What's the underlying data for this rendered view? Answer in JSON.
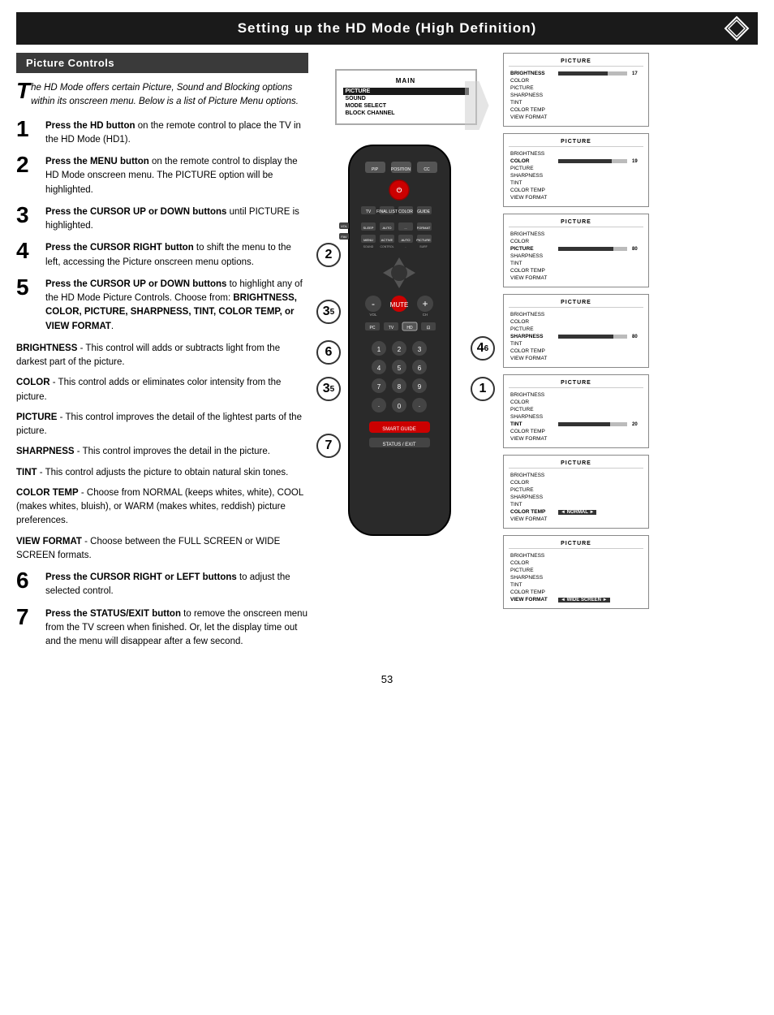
{
  "page": {
    "title": "Setting up the HD Mode (High Definition)",
    "page_number": "53"
  },
  "section": {
    "title": "Picture Controls"
  },
  "intro": {
    "drop_cap": "T",
    "text": "he HD Mode offers certain Picture, Sound and Blocking options within its onscreen menu. Below is a list of Picture Menu options."
  },
  "steps": [
    {
      "number": "1",
      "text": "Press the HD button on the remote control to place the TV in the HD Mode (HD1)."
    },
    {
      "number": "2",
      "text": "Press the MENU button on the remote control to display the HD Mode onscreen menu. The PICTURE option will be highlighted."
    },
    {
      "number": "3",
      "text": "Press the CURSOR UP or DOWN buttons until PICTURE is highlighted."
    },
    {
      "number": "4",
      "text": "Press the CURSOR RIGHT button to shift the menu to the left, accessing the Picture onscreen menu options."
    },
    {
      "number": "5",
      "text": "Press the CURSOR UP or DOWN buttons to highlight any of the HD Mode Picture Controls. Choose from: BRIGHTNESS, COLOR, PICTURE, SHARPNESS, TINT, COLOR TEMP, or VIEW FORMAT."
    }
  ],
  "descriptions": [
    {
      "term": "BRIGHTNESS",
      "text": "This control will adds or subtracts light from the darkest part of the picture."
    },
    {
      "term": "COLOR",
      "text": "This control adds or eliminates color intensity from the picture."
    },
    {
      "term": "PICTURE",
      "text": "This control improves the detail of the lightest parts of the picture."
    },
    {
      "term": "SHARPNESS",
      "text": "This control improves the detail in the picture."
    },
    {
      "term": "TINT",
      "text": "This control adjusts the picture to obtain natural skin tones."
    },
    {
      "term": "COLOR TEMP",
      "text": "Choose from NORMAL (keeps whites, white), COOL (makes whites, bluish), or WARM (makes whites, reddish) picture preferences."
    },
    {
      "term": "VIEW FORMAT",
      "text": "Choose between the FULL SCREEN or WIDE SCREEN formats."
    }
  ],
  "bottom_steps": [
    {
      "number": "6",
      "text": "Press the CURSOR RIGHT or LEFT buttons to adjust the selected control."
    },
    {
      "number": "7",
      "text": "Press the STATUS/EXIT button to remove the onscreen menu from the TV screen when finished. Or, let the display time out and the menu will disappear after a few second."
    }
  ],
  "tv_main_menu": {
    "title": "MAIN",
    "items": [
      "PICTURE",
      "SOUND",
      "MODE SELECT",
      "BLOCK CHANNEL"
    ],
    "highlighted": 0
  },
  "screenshots": [
    {
      "title": "PICTURE",
      "rows": [
        {
          "label": "BRIGHTNESS",
          "active": true,
          "has_bar": true,
          "bar_pct": 72,
          "value": "17"
        },
        {
          "label": "COLOR",
          "active": false,
          "has_bar": false
        },
        {
          "label": "PICTURE",
          "active": false,
          "has_bar": false
        },
        {
          "label": "SHARPNESS",
          "active": false,
          "has_bar": false
        },
        {
          "label": "TINT",
          "active": false,
          "has_bar": false
        },
        {
          "label": "COLOR TEMP",
          "active": false,
          "has_bar": false
        },
        {
          "label": "VIEW FORMAT",
          "active": false,
          "has_bar": false
        }
      ]
    },
    {
      "title": "PICTURE",
      "rows": [
        {
          "label": "BRIGHTNESS",
          "active": false,
          "has_bar": false
        },
        {
          "label": "COLOR",
          "active": true,
          "has_bar": true,
          "bar_pct": 78,
          "value": "19"
        },
        {
          "label": "PICTURE",
          "active": false,
          "has_bar": false
        },
        {
          "label": "SHARPNESS",
          "active": false,
          "has_bar": false
        },
        {
          "label": "TINT",
          "active": false,
          "has_bar": false
        },
        {
          "label": "COLOR TEMP",
          "active": false,
          "has_bar": false
        },
        {
          "label": "VIEW FORMAT",
          "active": false,
          "has_bar": false
        }
      ]
    },
    {
      "title": "PICTURE",
      "rows": [
        {
          "label": "BRIGHTNESS",
          "active": false,
          "has_bar": false
        },
        {
          "label": "COLOR",
          "active": false,
          "has_bar": false
        },
        {
          "label": "PICTURE",
          "active": true,
          "has_bar": true,
          "bar_pct": 80,
          "value": "80"
        },
        {
          "label": "SHARPNESS",
          "active": false,
          "has_bar": false
        },
        {
          "label": "TINT",
          "active": false,
          "has_bar": false
        },
        {
          "label": "COLOR TEMP",
          "active": false,
          "has_bar": false
        },
        {
          "label": "VIEW FORMAT",
          "active": false,
          "has_bar": false
        }
      ]
    },
    {
      "title": "PICTURE",
      "rows": [
        {
          "label": "BRIGHTNESS",
          "active": false,
          "has_bar": false
        },
        {
          "label": "COLOR",
          "active": false,
          "has_bar": false
        },
        {
          "label": "PICTURE",
          "active": false,
          "has_bar": false
        },
        {
          "label": "SHARPNESS",
          "active": true,
          "has_bar": true,
          "bar_pct": 80,
          "value": "80"
        },
        {
          "label": "TINT",
          "active": false,
          "has_bar": false
        },
        {
          "label": "COLOR TEMP",
          "active": false,
          "has_bar": false
        },
        {
          "label": "VIEW FORMAT",
          "active": false,
          "has_bar": false
        }
      ]
    },
    {
      "title": "PICTURE",
      "rows": [
        {
          "label": "BRIGHTNESS",
          "active": false,
          "has_bar": false
        },
        {
          "label": "COLOR",
          "active": false,
          "has_bar": false
        },
        {
          "label": "PICTURE",
          "active": false,
          "has_bar": false
        },
        {
          "label": "SHARPNESS",
          "active": false,
          "has_bar": false
        },
        {
          "label": "TINT",
          "active": true,
          "has_bar": true,
          "bar_pct": 75,
          "value": "20"
        },
        {
          "label": "COLOR TEMP",
          "active": false,
          "has_bar": false
        },
        {
          "label": "VIEW FORMAT",
          "active": false,
          "has_bar": false
        }
      ]
    },
    {
      "title": "PICTURE",
      "rows": [
        {
          "label": "BRIGHTNESS",
          "active": false,
          "has_bar": false
        },
        {
          "label": "COLOR",
          "active": false,
          "has_bar": false
        },
        {
          "label": "PICTURE",
          "active": false,
          "has_bar": false
        },
        {
          "label": "SHARPNESS",
          "active": false,
          "has_bar": false
        },
        {
          "label": "TINT",
          "active": false,
          "has_bar": false
        },
        {
          "label": "COLOR TEMP",
          "active": true,
          "has_bar": false,
          "text_value": "NORMAL"
        },
        {
          "label": "VIEW FORMAT",
          "active": false,
          "has_bar": false
        }
      ]
    },
    {
      "title": "PICTURE",
      "rows": [
        {
          "label": "BRIGHTNESS",
          "active": false,
          "has_bar": false
        },
        {
          "label": "COLOR",
          "active": false,
          "has_bar": false
        },
        {
          "label": "PICTURE",
          "active": false,
          "has_bar": false
        },
        {
          "label": "SHARPNESS",
          "active": false,
          "has_bar": false
        },
        {
          "label": "TINT",
          "active": false,
          "has_bar": false
        },
        {
          "label": "COLOR TEMP",
          "active": false,
          "has_bar": false
        },
        {
          "label": "VIEW FORMAT",
          "active": true,
          "has_bar": false,
          "text_value": "WIDE SCREEN"
        }
      ]
    }
  ]
}
